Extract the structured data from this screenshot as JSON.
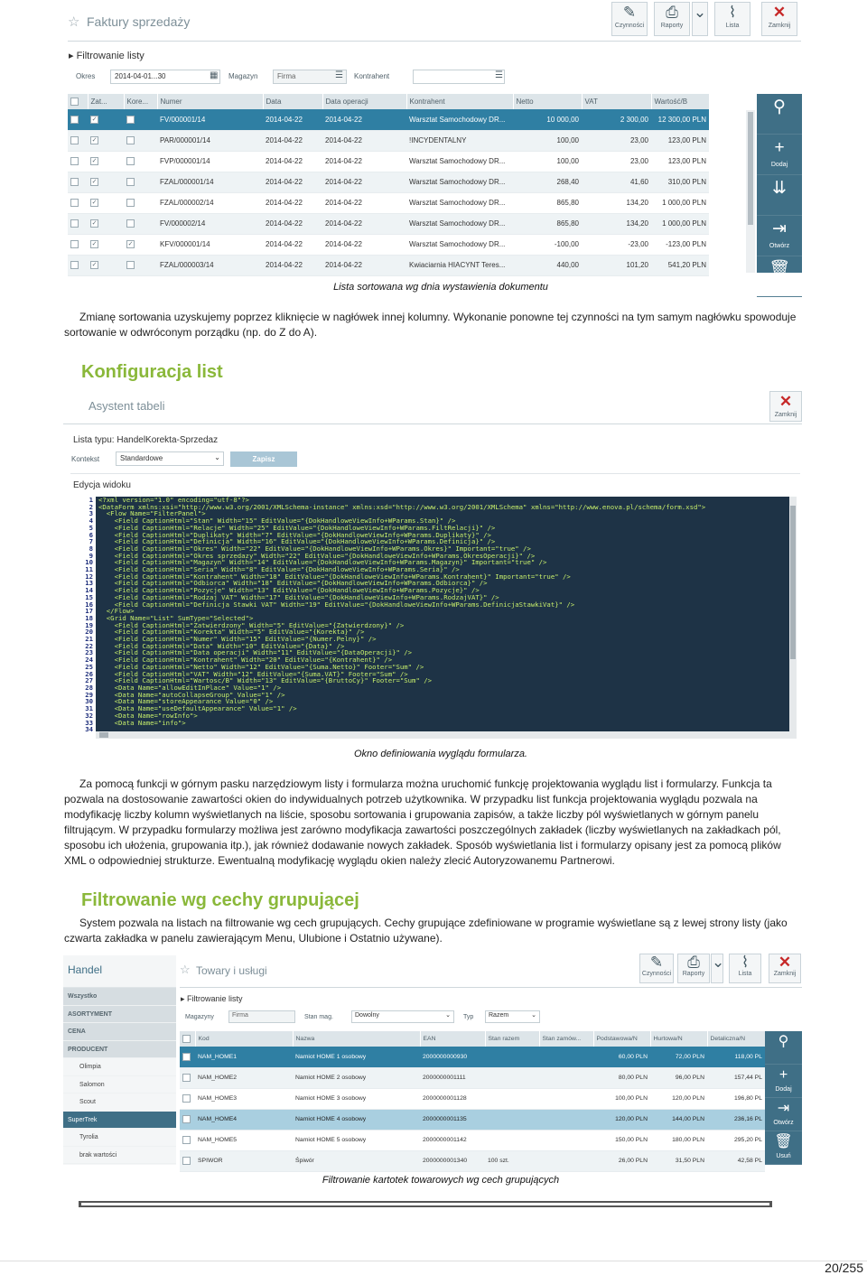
{
  "screen1": {
    "title": "Faktury sprzedaży",
    "toolbar": [
      "Czynności",
      "Raporty",
      "Lista",
      "Zamknij"
    ],
    "filter_title": "Filtrowanie listy",
    "filter": {
      "okres_label": "Okres",
      "okres_value": "2014-04-01...30",
      "magazyn_label": "Magazyn",
      "firma_value": "Firma",
      "kontrahent_label": "Kontrahent"
    },
    "columns": [
      "Zat...",
      "Kore...",
      "Numer",
      "Data",
      "Data operacji",
      "Kontrahent",
      "Netto",
      "VAT",
      "Wartość/B"
    ],
    "rows": [
      {
        "numer": "FV/000001/14",
        "data": "2014-04-22",
        "op": "2014-04-22",
        "kontr": "Warsztat Samochodowy DR...",
        "netto": "10 000,00",
        "vat": "2 300,00",
        "wart": "12 300,00 PLN",
        "z": true,
        "k": false
      },
      {
        "numer": "PAR/000001/14",
        "data": "2014-04-22",
        "op": "2014-04-22",
        "kontr": "!INCYDENTALNY",
        "netto": "100,00",
        "vat": "23,00",
        "wart": "123,00 PLN",
        "z": true,
        "k": false
      },
      {
        "numer": "FVP/000001/14",
        "data": "2014-04-22",
        "op": "2014-04-22",
        "kontr": "Warsztat Samochodowy DR...",
        "netto": "100,00",
        "vat": "23,00",
        "wart": "123,00 PLN",
        "z": true,
        "k": false
      },
      {
        "numer": "FZAL/000001/14",
        "data": "2014-04-22",
        "op": "2014-04-22",
        "kontr": "Warsztat Samochodowy DR...",
        "netto": "268,40",
        "vat": "41,60",
        "wart": "310,00 PLN",
        "z": true,
        "k": false
      },
      {
        "numer": "FZAL/000002/14",
        "data": "2014-04-22",
        "op": "2014-04-22",
        "kontr": "Warsztat Samochodowy DR...",
        "netto": "865,80",
        "vat": "134,20",
        "wart": "1 000,00 PLN",
        "z": true,
        "k": false
      },
      {
        "numer": "FV/000002/14",
        "data": "2014-04-22",
        "op": "2014-04-22",
        "kontr": "Warsztat Samochodowy DR...",
        "netto": "865,80",
        "vat": "134,20",
        "wart": "1 000,00 PLN",
        "z": true,
        "k": false
      },
      {
        "numer": "KFV/000001/14",
        "data": "2014-04-22",
        "op": "2014-04-22",
        "kontr": "Warsztat Samochodowy DR...",
        "netto": "-100,00",
        "vat": "-23,00",
        "wart": "-123,00 PLN",
        "z": true,
        "k": true
      },
      {
        "numer": "FZAL/000003/14",
        "data": "2014-04-22",
        "op": "2014-04-22",
        "kontr": "Kwiaciarnia HIACYNT Teres...",
        "netto": "440,00",
        "vat": "101,20",
        "wart": "541,20 PLN",
        "z": true,
        "k": false
      }
    ],
    "side": [
      "",
      "Dodaj",
      "",
      "Otwórz",
      "Usuń"
    ]
  },
  "caption1": "Lista sortowana wg dnia wystawienia dokumentu",
  "para1a": "Zmianę sortowania uzyskujemy poprzez kliknięcie w nagłówek innej kolumny. Wykonanie ponowne tej czynności na tym samym nagłówku spowoduje",
  "para1b": "sortowanie w odwróconym porządku (np. do Z do A).",
  "heading1": "Konfiguracja list",
  "screen2": {
    "title": "Asystent tabeli",
    "close": "Zamknij",
    "list_type": "Lista typu: HandelKorekta-Sprzedaz",
    "kontekst_label": "Kontekst",
    "kontekst_value": "Standardowe",
    "save": "Zapisz",
    "edit_title": "Edycja widoku",
    "code": "<?xml version=\"1.0\" encoding=\"utf-8\"?>\n<DataForm xmlns:xsi=\"http://www.w3.org/2001/XMLSchema-instance\" xmlns:xsd=\"http://www.w3.org/2001/XMLSchema\" xmlns=\"http://www.enova.pl/schema/form.xsd\">\n  <Flow Name=\"FilterPanel\">\n    <Field CaptionHtml=\"Stan\" Width=\"15\" EditValue=\"{DokHandloweViewInfo+WParams.Stan}\" />\n    <Field CaptionHtml=\"Relacje\" Width=\"25\" EditValue=\"{DokHandloweViewInfo+WParams.FiltRelacji}\" />\n    <Field CaptionHtml=\"Duplikaty\" Width=\"7\" EditValue=\"{DokHandloweViewInfo+WParams.Duplikaty}\" />\n    <Field CaptionHtml=\"Definicja\" Width=\"16\" EditValue=\"{DokHandloweViewInfo+WParams.Definicja}\" />\n    <Field CaptionHtml=\"Okres\" Width=\"22\" EditValue=\"{DokHandloweViewInfo+WParams.Okres}\" Important=\"true\" />\n    <Field CaptionHtml=\"Okres sprzedazy\" Width=\"22\" EditValue=\"{DokHandloweViewInfo+WParams.OkresOperacji}\" />\n    <Field CaptionHtml=\"Magazyn\" Width=\"14\" EditValue=\"{DokHandloweViewInfo+WParams.Magazyn}\" Important=\"true\" />\n    <Field CaptionHtml=\"Seria\" Width=\"8\" EditValue=\"{DokHandloweViewInfo+WParams.Seria}\" />\n    <Field CaptionHtml=\"Kontrahent\" Width=\"18\" EditValue=\"{DokHandloweViewInfo+WParams.Kontrahent}\" Important=\"true\" />\n    <Field CaptionHtml=\"Odbiorca\" Width=\"18\" EditValue=\"{DokHandloweViewInfo+WParams.Odbiorca}\" />\n    <Field CaptionHtml=\"Pozycje\" Width=\"13\" EditValue=\"{DokHandloweViewInfo+WParams.Pozycje}\" />\n    <Field CaptionHtml=\"Rodzaj VAT\" Width=\"17\" EditValue=\"{DokHandloweViewInfo+WParams.RodzajVAT}\" />\n    <Field CaptionHtml=\"Definicja Stawki VAT\" Width=\"19\" EditValue=\"{DokHandloweViewInfo+WParams.DefinicjaStawkiVat}\" />\n  </Flow>\n  <Grid Name=\"List\" SumType=\"Selected\">\n    <Field CaptionHtml=\"Zatwierdzony\" Width=\"5\" EditValue=\"{Zatwierdzony}\" />\n    <Field CaptionHtml=\"Korekta\" Width=\"5\" EditValue=\"{Korekta}\" />\n    <Field CaptionHtml=\"Numer\" Width=\"15\" EditValue=\"{Numer.Pelny}\" />\n    <Field CaptionHtml=\"Data\" Width=\"10\" EditValue=\"{Data}\" />\n    <Field CaptionHtml=\"Data operacji\" Width=\"11\" EditValue=\"{DataOperacji}\" />\n    <Field CaptionHtml=\"Kontrahent\" Width=\"20\" EditValue=\"{Kontrahent}\" />\n    <Field CaptionHtml=\"Netto\" Width=\"12\" EditValue=\"{Suma.Netto}\" Footer=\"Sum\" />\n    <Field CaptionHtml=\"VAT\" Width=\"12\" EditValue=\"{Suma.VAT}\" Footer=\"Sum\" />\n    <Field CaptionHtml=\"Wartosc/B\" Width=\"13\" EditValue=\"{BruttoCy}\" Footer=\"Sum\" />\n    <Data Name=\"allowEditInPlace\" Value=\"1\" />\n    <Data Name=\"autoCollapseGroup\" Value=\"1\" />\n    <Data Name=\"storeAppearance Value=\"0\" />\n    <Data Name=\"useDefaultAppearance\" Value=\"1\" />\n    <Data Name=\"rowInfo\">\n    <Data Name=\"info\">",
    "line_count": 34
  },
  "caption2": "Okno definiowania wyglądu formularza.",
  "para2": [
    "Za pomocą funkcji w górnym pasku narzędziowym listy i formularza można uruchomić funkcję projektowania wyglądu list i formularzy. Funkcja ta",
    "pozwala na dostosowanie zawartości okien do indywidualnych potrzeb użytkownika. W przypadku list funkcja projektowania wyglądu pozwala na",
    "modyfikację liczby kolumn wyświetlanych na liście, sposobu sortowania i grupowania zapisów, a także liczby pól wyświetlanych w górnym panelu",
    "filtrującym. W przypadku formularzy możliwa jest zarówno modyfikacja zawartości poszczególnych zakładek (liczby wyświetlanych na zakładkach pól,",
    "sposobu ich ułożenia, grupowania itp.), jak również dodawanie nowych zakładek. Sposób wyświetlania list i formularzy opisany jest za pomocą plików",
    "XML o odpowiedniej strukturze. Ewentualną modyfikację wyglądu okien należy zlecić Autoryzowanemu Partnerowi."
  ],
  "heading2": "Filtrowanie wg cechy grupującej",
  "para3": [
    "System pozwala na listach na filtrowanie wg cech grupujących. Cechy grupujące zdefiniowane w programie wyświetlane są z lewej strony listy (jako",
    "czwarta zakładka w panelu zawierającym Menu, Ulubione i Ostatnio używane)."
  ],
  "screen3": {
    "nav_title": "Handel",
    "nav": [
      {
        "t": "Wszystko",
        "c": "hdr"
      },
      {
        "t": "ASORTYMENT",
        "c": "hdr"
      },
      {
        "t": "CENA",
        "c": "hdr"
      },
      {
        "t": "PRODUCENT",
        "c": "hdr"
      },
      {
        "t": "Olimpia",
        "c": ""
      },
      {
        "t": "Salomon",
        "c": ""
      },
      {
        "t": "Scout",
        "c": ""
      },
      {
        "t": "SuperTrek",
        "c": "act"
      },
      {
        "t": "Tyrolia",
        "c": ""
      },
      {
        "t": "brak wartości",
        "c": ""
      }
    ],
    "title": "Towary i usługi",
    "toolbar": [
      "Czynności",
      "Raporty",
      "Lista",
      "Zamknij"
    ],
    "filter_title": "Filtrowanie listy",
    "filter": {
      "mag_label": "Magazyny",
      "mag_value": "Firma",
      "stan_label": "Stan mag.",
      "stan_value": "Dowolny",
      "typ_label": "Typ",
      "typ_value": "Razem"
    },
    "columns": [
      "Kod",
      "Nazwa",
      "EAN",
      "Stan razem",
      "Stan zamów...",
      "Podstawowa/N",
      "Hurtowa/N",
      "Detaliczna/N"
    ],
    "rows": [
      {
        "kod": "NAM_HOME1",
        "nazwa": "Namiot HOME 1 osobowy",
        "ean": "2000000000930",
        "a": "",
        "b": "",
        "p": "60,00 PLN",
        "h": "72,00 PLN",
        "d": "118,00 PL"
      },
      {
        "kod": "NAM_HOME2",
        "nazwa": "Namiot HOME 2 osobowy",
        "ean": "2000000001111",
        "a": "",
        "b": "",
        "p": "80,00 PLN",
        "h": "96,00 PLN",
        "d": "157,44 PL"
      },
      {
        "kod": "NAM_HOME3",
        "nazwa": "Namiot HOME 3 osobowy",
        "ean": "2000000001128",
        "a": "",
        "b": "",
        "p": "100,00 PLN",
        "h": "120,00 PLN",
        "d": "196,80 PL"
      },
      {
        "kod": "NAM_HOME4",
        "nazwa": "Namiot HOME 4 osobowy",
        "ean": "2000000001135",
        "a": "",
        "b": "",
        "p": "120,00 PLN",
        "h": "144,00 PLN",
        "d": "236,16 PL"
      },
      {
        "kod": "NAM_HOME5",
        "nazwa": "Namiot HOME 5 osobowy",
        "ean": "2000000001142",
        "a": "",
        "b": "",
        "p": "150,00 PLN",
        "h": "180,00 PLN",
        "d": "295,20 PL"
      },
      {
        "kod": "SPIWOR",
        "nazwa": "Śpiwór",
        "ean": "2000000001340",
        "a": "100 szt.",
        "b": "",
        "p": "26,00 PLN",
        "h": "31,50 PLN",
        "d": "42,58 PL"
      }
    ],
    "side": [
      "",
      "Dodaj",
      "Otwórz",
      "Usuń"
    ]
  },
  "caption3": "Filtrowanie kartotek towarowych wg cech grupujących",
  "page_number": "20/255"
}
